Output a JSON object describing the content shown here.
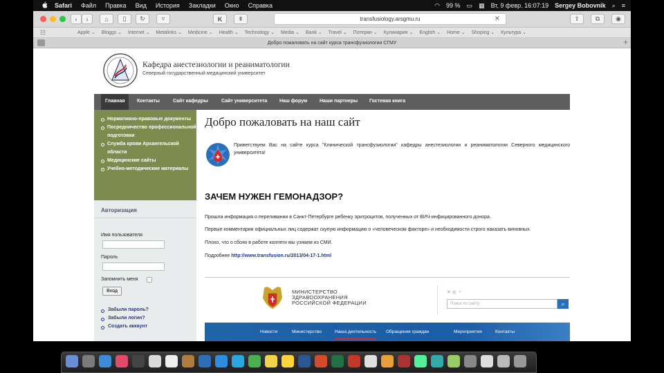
{
  "menubar": {
    "apple": "",
    "items": [
      "Safari",
      "Файл",
      "Правка",
      "Вид",
      "История",
      "Закладки",
      "Окно",
      "Справка"
    ],
    "battery": "99 %",
    "clock": "Вт, 9 февр.  16:07:19",
    "user": "Sergey Bobovnik"
  },
  "browser": {
    "url": "transfusiology.arsgmu.ru",
    "page_tab_title": "Добро пожаловать на сайт курса трансфузиологии СГМУ",
    "favorites": [
      "Apple",
      "Bloggs",
      "Internet",
      "Metalinks",
      "Medicine",
      "Health",
      "Technology",
      "Media",
      "Bank",
      "Travel",
      "Потерян",
      "Кулинария",
      "English",
      "Home",
      "Shoping",
      "Культура"
    ]
  },
  "site": {
    "header_title": "Кафедра анестезиологии и реаниматологии",
    "header_subtitle": "Северный государственный медицинский университет",
    "nav": [
      "Главная",
      "Контакты",
      "Сайт кафедры",
      "Сайт университета",
      "Наш форум",
      "Наши партнеры",
      "Гостевая книга"
    ],
    "sidebar_links": [
      "Нормативно-правовые документы",
      "Посредничество профессиональной подготовки",
      "Служба крови Архангельской области",
      "Медицинские сайты",
      "Учебно-методические материалы"
    ],
    "login": {
      "title": "Авторизация",
      "username_label": "Имя пользователя",
      "password_label": "Пароль",
      "remember_label": "Запомнить меня",
      "submit": "Вход",
      "links": [
        "Забыли пароль?",
        "Забыли логин?",
        "Создать аккаунт"
      ]
    },
    "main": {
      "title": "Добро пожаловать на наш сайт",
      "welcome": "Приветствуем Вас на сайте курса \"Клинической трансфузиологии\" кафедры анестезиологии и реаниматологии Северного медицинского университета!",
      "heading": "ЗАЧЕМ НУЖЕН ГЕМОНАДЗОР?",
      "p1": "Прошла информация о переливании в Санкт-Петербурге ребенку эритроцитов, полученных от ВИЧ-инфицированного донора.",
      "p2": "Первые комментарии официальных лиц содержат скупую информацию о «человеческом факторе» и необходимости строго наказать виновных.",
      "p3": "Плохо, что о сбоях в работе коллеги мы узнаем из СМИ.",
      "more_label": "Подробнее",
      "more_link": "http://www.transfusion.ru/2013/04-17-1.html"
    },
    "banner": {
      "org": [
        "МИНИСТЕРСТВО",
        "ЗДРАВООХРАНЕНИЯ",
        "РОССИЙСКОЙ ФЕДЕРАЦИИ"
      ],
      "lang": "✕ ◎ ◔",
      "search_placeholder": "Поиск по сайту",
      "nav": [
        "Новости",
        "Министерство",
        "Наша деятельность",
        "Обращения граждан",
        "Мероприятия",
        "Контакты"
      ]
    }
  },
  "colors": {
    "sidebar": "#7d8c4e",
    "nav": "#5e5e5e",
    "banner_nav": "#2264a8",
    "link": "#1a3b8a"
  }
}
